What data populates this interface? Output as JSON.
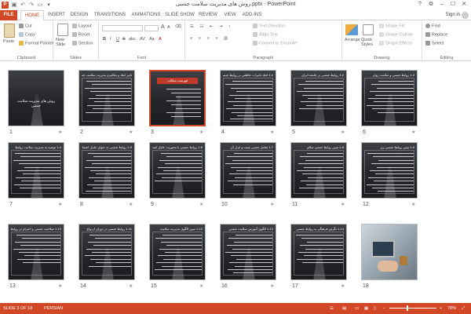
{
  "title": "روش های مدیریت سلامت جنسی.pptx - PowerPoint",
  "app_icon": "P",
  "qat": [
    "save-icon",
    "undo-icon",
    "redo-icon",
    "start-from-beginning-icon",
    "customize-qat-icon"
  ],
  "window_buttons": {
    "help": "?",
    "restore": "⧉",
    "minimize": "–",
    "maximize": "☐",
    "close": "✕"
  },
  "tabs": [
    "FILE",
    "HOME",
    "INSERT",
    "DESIGN",
    "TRANSITIONS",
    "ANIMATIONS",
    "SLIDE SHOW",
    "REVIEW",
    "VIEW",
    "ADD-INS"
  ],
  "active_tab": "HOME",
  "sign_in": "Sign in",
  "ribbon": {
    "clipboard": {
      "paste": "Paste",
      "cut": "Cut",
      "copy": "Copy",
      "format_painter": "Format Painter",
      "label": "Clipboard"
    },
    "slides": {
      "new_slide": "New Slide",
      "layout": "Layout",
      "reset": "Reset",
      "section": "Section",
      "label": "Slides"
    },
    "font": {
      "label": "Font",
      "bold": "B",
      "italic": "I",
      "underline": "U",
      "strike": "S",
      "shadow": "abc",
      "spacing": "AV",
      "case": "Aa",
      "font_color": "A",
      "grow": "A",
      "shrink": "A"
    },
    "paragraph": {
      "text_direction": "Text Direction",
      "align_text": "Align Text",
      "convert_smartart": "Convert to SmartArt",
      "label": "Paragraph"
    },
    "drawing": {
      "arrange": "Arrange",
      "quick_styles": "Quick Styles",
      "shape_fill": "Shape Fill",
      "shape_outline": "Shape Outline",
      "shape_effects": "Shape Effects",
      "label": "Drawing"
    },
    "editing": {
      "find": "Find",
      "replace": "Replace",
      "select": "Select",
      "label": "Editing"
    }
  },
  "slides": [
    {
      "n": "1",
      "title": "روش های مدیریت سلامت جنسی",
      "kind": "cover"
    },
    {
      "n": "2",
      "title": "تاثیر ابعاد و مکانیزم مدیریت سلامت جنسی",
      "kind": "text"
    },
    {
      "n": "3",
      "title": "فهرست مطالب",
      "kind": "list"
    },
    {
      "n": "4",
      "title": "1-1 ابعاد تاثیرات عاطفی بر روابط جنسی",
      "kind": "text"
    },
    {
      "n": "5",
      "title": "1-2 روابط جنسی در جامعه ایران",
      "kind": "text"
    },
    {
      "n": "6",
      "title": "1-3 روابط جنسی و سلامت روان",
      "kind": "text"
    },
    {
      "n": "7",
      "title": "1-4 توصیه به مدیریت سلامت روابط",
      "kind": "text"
    },
    {
      "n": "8",
      "title": "1-5 روابط جنسی به عنوان عامل اجتماعی",
      "kind": "text"
    },
    {
      "n": "9",
      "title": "1-6 روابط جنسی با محوریت عامل انسانی",
      "kind": "text"
    },
    {
      "n": "10",
      "title": "1-7 تعامل جنسی مثبت و ابزار آن",
      "kind": "text"
    },
    {
      "n": "11",
      "title": "1-8 تبیین روابط جنسی سالم",
      "kind": "text"
    },
    {
      "n": "12",
      "title": "1-9 تبیین روابط جنسی زن",
      "kind": "text"
    },
    {
      "n": "13",
      "title": "1-10 صلاحیت جنسی و احترام در روابط",
      "kind": "text"
    },
    {
      "n": "14",
      "title": "1-11 روابط جنسی در دوران ازدواج",
      "kind": "text"
    },
    {
      "n": "15",
      "title": "1-12 تبیین الگوی مدیریت سلامت",
      "kind": "text"
    },
    {
      "n": "16",
      "title": "1-13 الگوی آموزش سلامت جنسی",
      "kind": "text"
    },
    {
      "n": "17",
      "title": "1-14 نگرش فرهنگی به روابط جنسی",
      "kind": "text"
    },
    {
      "n": "18",
      "title": "",
      "kind": "photo"
    }
  ],
  "selected_slide": "3",
  "status": {
    "slide_info": "SLIDE 3 OF 18",
    "language": "PERSIAN",
    "zoom": "78%",
    "zoom_fraction": 0.78
  }
}
